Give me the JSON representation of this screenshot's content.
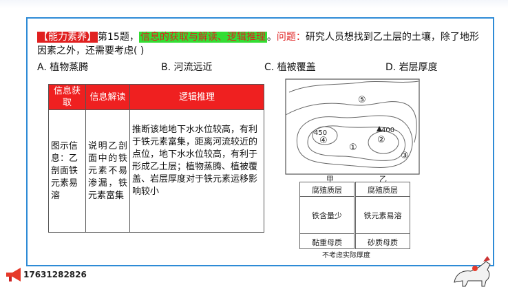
{
  "question": {
    "tag": "【能力素养】",
    "number": "第15题，",
    "highlight": "信息的获取与解读、逻辑推理",
    "sep": "。",
    "label": "问题：",
    "text": "研究人员想找到乙土层的土壤，除了地形因素之外，还需要考虑(    )"
  },
  "options": [
    {
      "text": "A. 植物蒸腾"
    },
    {
      "text": "B. 河流远近"
    },
    {
      "text": "C. 植被覆盖"
    },
    {
      "text": "D. 岩层厚度"
    }
  ],
  "table": {
    "headers": [
      "信息获取",
      "信息解读",
      "逻辑推理"
    ],
    "row": [
      "图示信息：乙剖面铁元素易溶",
      "说明乙剖面中的铁元素不易渗漏，铁元素富集",
      "推断该地地下水水位较高，有利于铁元素富集，距离河流较近的点位，地下水水位较高，有利于形成乙土层；植物蒸腾、植被覆盖、岩层厚度对于铁元素运移影响较小"
    ]
  },
  "map": {
    "labels": [
      "⑤",
      "450",
      "④",
      "①",
      "400",
      "②",
      "③"
    ]
  },
  "profiles": {
    "jia": {
      "name": "甲",
      "layers": [
        "腐殖质层",
        "铁含量少",
        "黏重母质"
      ]
    },
    "yi": {
      "name": "乙",
      "layers": [
        "腐殖质层",
        "铁元素易溶",
        "砂质母质"
      ]
    },
    "caption": "不考虑实际厚度"
  },
  "footer": {
    "phone": "17631282826"
  },
  "colors": {
    "accent_red": "#e02020",
    "highlight_green": "#33dd33",
    "frame_blue": "#2e8bd6"
  }
}
